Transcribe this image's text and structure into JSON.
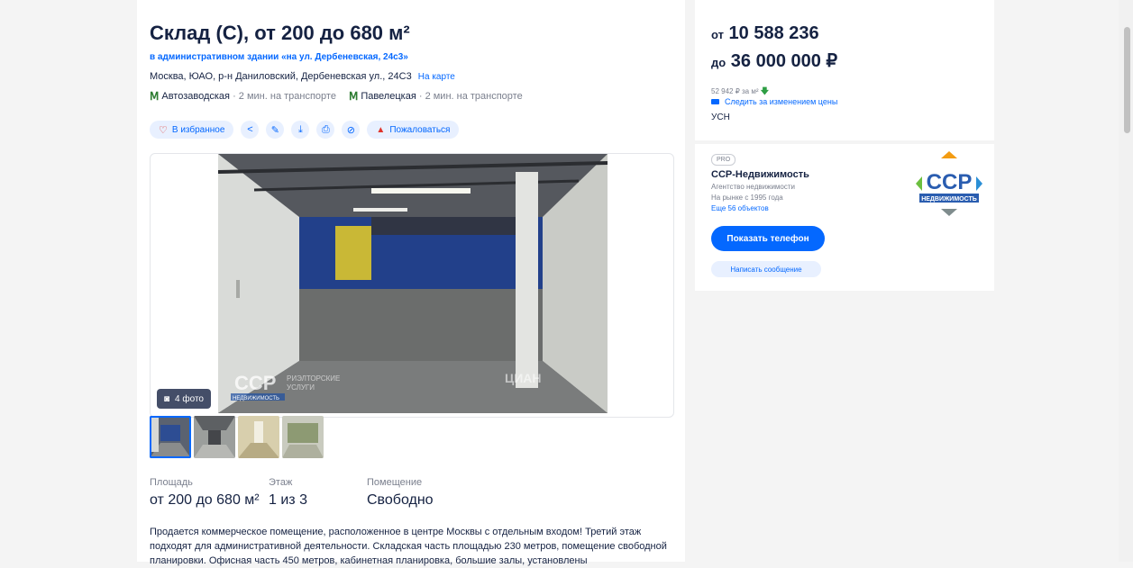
{
  "listing": {
    "title": "Склад (С), от 200 до 680 м²",
    "building_link": "в административном здании «на ул. Дербеневская, 24с3»",
    "address": "Москва, ЮАО, р-н Даниловский, Дербеневская ул., 24С3",
    "map_link": "На карте",
    "metro": [
      {
        "station": "Автозаводская",
        "time": "· 2 мин. на транспорте"
      },
      {
        "station": "Павелецкая",
        "time": "· 2 мин. на транспорте"
      }
    ]
  },
  "actions": {
    "favorite": "В избранное",
    "report": "Пожаловаться",
    "icons": [
      "share-icon",
      "edit-icon",
      "download-icon",
      "print-icon",
      "hide-icon"
    ]
  },
  "gallery": {
    "photo_count": "4 фото",
    "watermark_brand": "CCP",
    "watermark_sub": "НЕДВИЖИМОСТЬ",
    "watermark_text1": "РИЭЛТОРСКИЕ",
    "watermark_text2": "УСЛУГИ",
    "watermark_cian": "ЦИАН",
    "thumbnails": 4
  },
  "features": [
    {
      "label": "Площадь",
      "value": "от 200 до 680 м²"
    },
    {
      "label": "Этаж",
      "value": "1 из 3"
    },
    {
      "label": "Помещение",
      "value": "Свободно"
    }
  ],
  "description": "Продается коммерческое помещение, расположенное в центре Москвы с отдельным входом! Третий этаж подходят для административной деятельности. Складская часть площадью 230 метров, помещение свободной планировки. Офисная часть 450 метров, кабинетная планировка, большие залы, установлены",
  "price": {
    "from_prefix": "от",
    "from_value": "10 588 236",
    "to_prefix": "до",
    "to_value": "36 000 000 ₽",
    "per_m": "52 942 ₽ за м²",
    "follow": "Следить за изменением цены",
    "tax": "УСН"
  },
  "agent": {
    "badge": "PRO",
    "name": "ССР-Недвижимость",
    "type": "Агентство недвижимости",
    "since": "На рынке с 1995 года",
    "more": "Еще 56 объектов",
    "logo_text": "CCP",
    "logo_sub": "НЕДВИЖИМОСТЬ",
    "phone_button": "Показать телефон",
    "message_button": "Написать сообщение"
  },
  "colors": {
    "accent": "#0468ff",
    "metro": "#2e7d32",
    "alert": "#e0342b"
  }
}
